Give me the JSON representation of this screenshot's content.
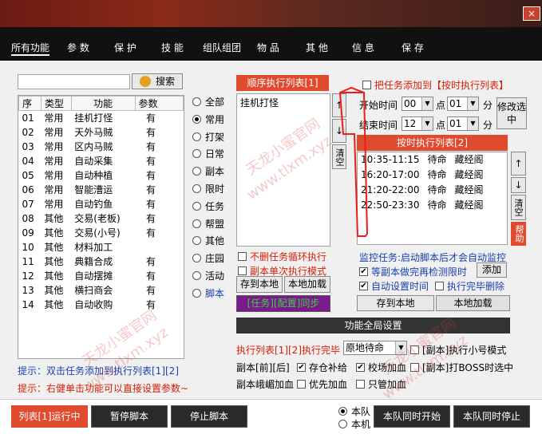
{
  "tabs": [
    "所有功能",
    "参 数",
    "保 护",
    "技 能",
    "组队组团",
    "物 品",
    "其 他",
    "信 息",
    "保 存"
  ],
  "close_label": "×",
  "search": {
    "value": "",
    "button": "搜索"
  },
  "func_table": {
    "headers": [
      "序",
      "类型",
      "功能",
      "参数"
    ],
    "rows": [
      [
        "01",
        "常用",
        "挂机打怪",
        "有"
      ],
      [
        "02",
        "常用",
        "天外马贼",
        "有"
      ],
      [
        "03",
        "常用",
        "区内马贼",
        "有"
      ],
      [
        "04",
        "常用",
        "自动采集",
        "有"
      ],
      [
        "05",
        "常用",
        "自动种植",
        "有"
      ],
      [
        "06",
        "常用",
        "智能漕运",
        "有"
      ],
      [
        "07",
        "常用",
        "自动钓鱼",
        "有"
      ],
      [
        "08",
        "其他",
        "交易(老板)",
        "有"
      ],
      [
        "09",
        "其他",
        "交易(小号)",
        "有"
      ],
      [
        "10",
        "其他",
        "材料加工",
        ""
      ],
      [
        "11",
        "其他",
        "典籍合成",
        "有"
      ],
      [
        "12",
        "其他",
        "自动摆摊",
        "有"
      ],
      [
        "13",
        "其他",
        "横扫商会",
        "有"
      ],
      [
        "14",
        "其他",
        "自动收购",
        "有"
      ]
    ]
  },
  "categories": [
    {
      "label": "全部",
      "selected": false
    },
    {
      "label": "常用",
      "selected": true
    },
    {
      "label": "打架",
      "selected": false
    },
    {
      "label": "日常",
      "selected": false
    },
    {
      "label": "副本",
      "selected": false
    },
    {
      "label": "限时",
      "selected": false
    },
    {
      "label": "任务",
      "selected": false
    },
    {
      "label": "帮盟",
      "selected": false
    },
    {
      "label": "其他",
      "selected": false
    },
    {
      "label": "庄园",
      "selected": false
    },
    {
      "label": "活动",
      "selected": false
    },
    {
      "label": "脚本",
      "selected": false
    }
  ],
  "tips": {
    "tip1": "提示：双击任务添加到执行列表[1][2]",
    "tip2": "提示：右健单击功能可以直接设置参数~"
  },
  "seq_list": {
    "title": "顺序执行列表[1]",
    "items": [
      "挂机打怪"
    ],
    "up": "↑",
    "down": "↓",
    "clear": "清空",
    "opt_no_delete": "不删任务循环执行",
    "opt_single": "副本单次执行模式",
    "save_local": "存到本地",
    "load_local": "本地加载",
    "sync": "[任务][配置]同步"
  },
  "timed": {
    "add_check": "把任务添加到【按时执行列表】",
    "start_label": "开始时间",
    "end_label": "结束时间",
    "start_hour": "00",
    "start_min": "01",
    "end_hour": "12",
    "end_min": "01",
    "dot": "点",
    "min": "分",
    "edit": "修改选中",
    "title": "按时执行列表[2]",
    "items": [
      {
        "time": "10:35-11:15",
        "status": "待命",
        "task": "藏经阁"
      },
      {
        "time": "16:20-17:00",
        "status": "待命",
        "task": "藏经阁"
      },
      {
        "time": "21:20-22:00",
        "status": "待命",
        "task": "藏经阁"
      },
      {
        "time": "22:50-23:30",
        "status": "待命",
        "task": "藏经阁"
      }
    ],
    "up": "↑",
    "down": "↓",
    "clear": "清空",
    "help": "帮助",
    "monitor_text": "监控任务:启动脚本后才会自动监控",
    "wait_done": "等副本做完再检测限时",
    "add": "添加",
    "auto_time": "自动设置时间",
    "exec_delete": "执行完毕删除",
    "save_local": "存到本地",
    "load_local": "本地加载"
  },
  "global": {
    "title": "功能全局设置",
    "exec_done": "执行列表[1][2]执行完毕",
    "exec_done_value": "原地待命",
    "small_mode": "[副本]执行小号模式",
    "dungeon_front_back": "副本[前][后]",
    "warehouse_supply": "存仓补给",
    "school_refill": "校场加血",
    "boss_select": "[副本]打BOSS时选中",
    "blood_label": "副本峨嵋加血",
    "priority_blood": "优先加血",
    "only_tube_blood": "只管加血"
  },
  "bottom": {
    "run": "列表[1]运行中",
    "pause": "暂停脚本",
    "stop": "停止脚本",
    "team": "本队",
    "machine": "本机",
    "team_start": "本队同时开始",
    "team_stop": "本队同时停止"
  },
  "watermarks": [
    "天龙小蜜官网",
    "www.tlxm.xyz"
  ]
}
